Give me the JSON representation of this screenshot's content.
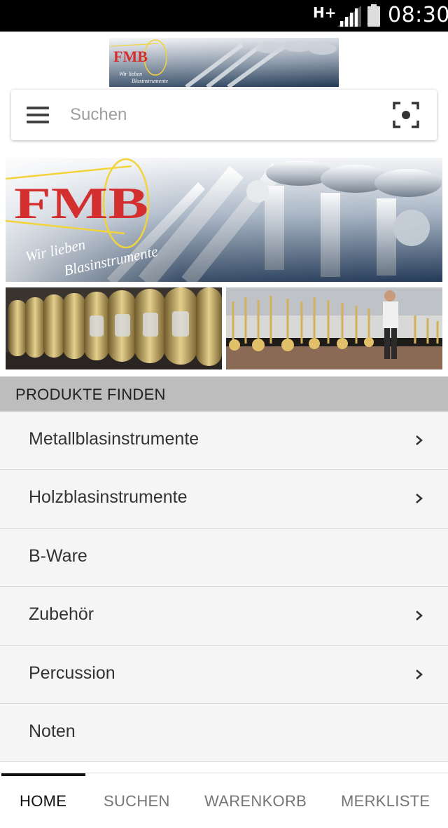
{
  "status_bar": {
    "network": "H+",
    "time": "08:30",
    "icons": [
      "network-type-icon",
      "signal-icon",
      "battery-icon"
    ]
  },
  "brand": {
    "logo_text": "FMB",
    "slogan_line1": "Wir lieben",
    "slogan_line2": "Blasinstrumente",
    "logo_color": "#d32f2f"
  },
  "search": {
    "placeholder": "Suchen",
    "menu_icon": "hamburger-menu-icon",
    "scan_icon": "barcode-scan-icon"
  },
  "section": {
    "title": "PRODUKTE FINDEN"
  },
  "categories": [
    {
      "label": "Metallblasinstrumente",
      "has_children": true
    },
    {
      "label": "Holzblasinstrumente",
      "has_children": true
    },
    {
      "label": "B-Ware",
      "has_children": false
    },
    {
      "label": "Zubehör",
      "has_children": true
    },
    {
      "label": "Percussion",
      "has_children": true
    },
    {
      "label": "Noten",
      "has_children": false
    }
  ],
  "bottom_nav": {
    "items": [
      {
        "label": "HOME",
        "active": true
      },
      {
        "label": "SUCHEN",
        "active": false
      },
      {
        "label": "WARENKORB",
        "active": false
      },
      {
        "label": "MERKLISTE",
        "active": false
      }
    ]
  },
  "colors": {
    "section_header_bg": "#bdbdbd",
    "list_bg": "#f5f5f5",
    "nav_active": "#111111",
    "nav_inactive": "#757575"
  }
}
